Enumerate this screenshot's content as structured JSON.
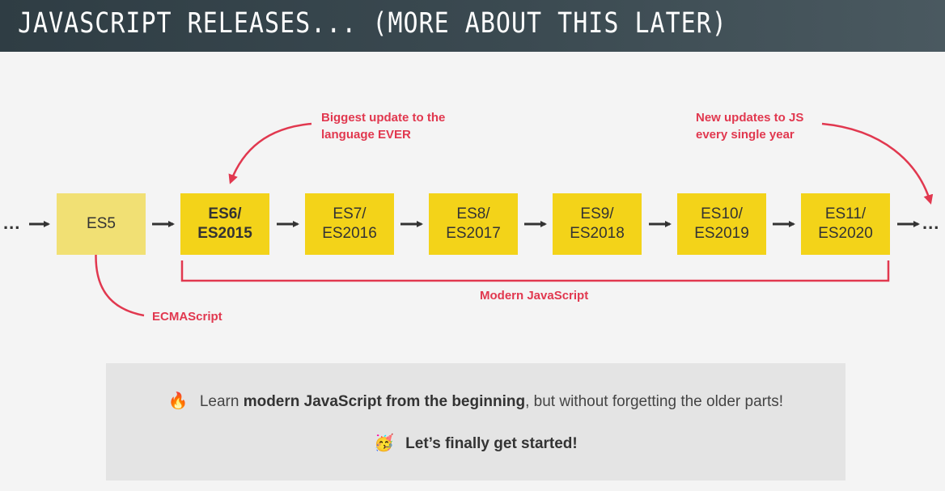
{
  "header": {
    "title": "JAVASCRIPT RELEASES... (MORE ABOUT THIS LATER)"
  },
  "timeline": {
    "leading_ellipsis": "...",
    "trailing_ellipsis": "...",
    "releases": [
      {
        "line1": "ES5",
        "line2": ""
      },
      {
        "line1": "ES6/",
        "line2": "ES2015"
      },
      {
        "line1": "ES7/",
        "line2": "ES2016"
      },
      {
        "line1": "ES8/",
        "line2": "ES2017"
      },
      {
        "line1": "ES9/",
        "line2": "ES2018"
      },
      {
        "line1": "ES10/",
        "line2": "ES2019"
      },
      {
        "line1": "ES11/",
        "line2": "ES2020"
      }
    ]
  },
  "annotations": {
    "biggest_update": {
      "line1": "Biggest update to the",
      "line2": "language EVER"
    },
    "yearly_updates": {
      "line1": "New updates to JS",
      "line2": "every single year"
    },
    "ecmascript": "ECMAScript",
    "modern_js": "Modern JavaScript"
  },
  "callout": {
    "line1_emoji": "🔥",
    "line1_pre": "Learn ",
    "line1_bold": "modern JavaScript from the beginning",
    "line1_post": ", but without forgetting the older parts!",
    "line2_emoji": "🥳",
    "line2_text": "Let’s finally get started!"
  },
  "colors": {
    "header_bg": "#2f3d44",
    "box_yellow": "#f3d319",
    "box_light_yellow": "#f1e074",
    "accent_red": "#e1384f",
    "callout_bg": "#e4e4e4"
  }
}
